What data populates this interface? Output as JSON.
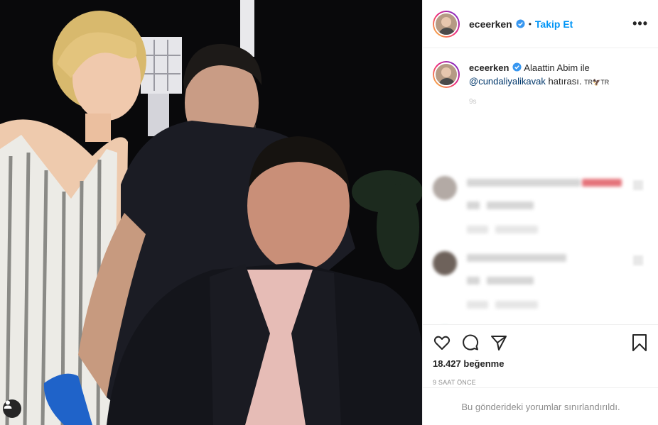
{
  "post": {
    "username": "eceerken",
    "dot": "•",
    "follow_label": "Takip Et",
    "more_icon": "more-options-icon",
    "caption_prefix": "Alaattin Abim ile",
    "caption_mention": "@cundaliyalikavak",
    "caption_suffix": "hatırası.",
    "caption_flags": "TR🦅TR",
    "caption_time": "9s",
    "likes_text": "18.427 beğenme",
    "time_ago": "9 SAAT ÖNCE",
    "comments_restricted": "Bu gönderideki yorumlar sınırlandırıldı."
  },
  "colors": {
    "accent": "#0095f6",
    "verified": "#3897f0",
    "text": "#262626",
    "muted": "#8e8e8e",
    "border": "#efefef"
  },
  "icons": [
    "heart-icon",
    "comment-icon",
    "share-icon",
    "save-icon",
    "verified-badge-icon",
    "tag-people-icon"
  ]
}
